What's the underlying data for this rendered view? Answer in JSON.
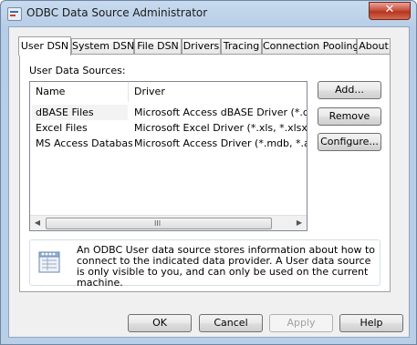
{
  "window": {
    "title": "ODBC Data Source Administrator",
    "close_label": "✕"
  },
  "tabs": [
    {
      "label": "User DSN",
      "active": true
    },
    {
      "label": "System DSN",
      "active": false
    },
    {
      "label": "File DSN",
      "active": false
    },
    {
      "label": "Drivers",
      "active": false
    },
    {
      "label": "Tracing",
      "active": false
    },
    {
      "label": "Connection Pooling",
      "active": false
    },
    {
      "label": "About",
      "active": false
    }
  ],
  "user_dsn": {
    "section_label": "User Data Sources:",
    "columns": [
      "Name",
      "Driver"
    ],
    "rows": [
      {
        "name": "dBASE Files",
        "driver": "Microsoft Access dBASE Driver (*.dbf, *.ndx"
      },
      {
        "name": "Excel Files",
        "driver": "Microsoft Excel Driver (*.xls, *.xlsx, *.xlsm, *.x"
      },
      {
        "name": "MS Access Database",
        "driver": "Microsoft Access Driver (*.mdb, *.accdb)"
      }
    ],
    "scroll_grip": "III",
    "buttons": {
      "add": "Add...",
      "remove": "Remove",
      "configure": "Configure..."
    },
    "info_text": "An ODBC User data source stores information about how to connect to the indicated data provider.  A User data source is only visible to you, and can only be used on the current machine."
  },
  "footer": {
    "ok": "OK",
    "cancel": "Cancel",
    "apply": "Apply",
    "help": "Help"
  }
}
